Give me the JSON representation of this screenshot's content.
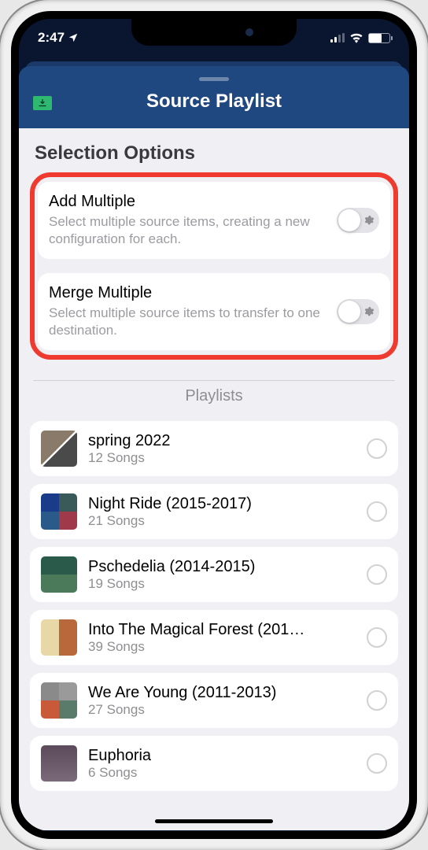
{
  "status": {
    "time": "2:47"
  },
  "header": {
    "title": "Source Playlist"
  },
  "section": {
    "label": "Selection Options"
  },
  "options": {
    "add": {
      "title": "Add Multiple",
      "desc": "Select multiple source items, creating a new configuration for each."
    },
    "merge": {
      "title": "Merge Multiple",
      "desc": "Select multiple source items to transfer to one destination."
    }
  },
  "list_header": "Playlists",
  "playlists": [
    {
      "title": "spring 2022",
      "sub": "12 Songs"
    },
    {
      "title": "Night Ride (2015-2017)",
      "sub": "21 Songs"
    },
    {
      "title": "Pschedelia (2014-2015)",
      "sub": "19 Songs"
    },
    {
      "title": "Into The Magical Forest (201…",
      "sub": "39 Songs"
    },
    {
      "title": "We Are Young (2011-2013)",
      "sub": "27 Songs"
    },
    {
      "title": "Euphoria",
      "sub": "6 Songs"
    }
  ]
}
